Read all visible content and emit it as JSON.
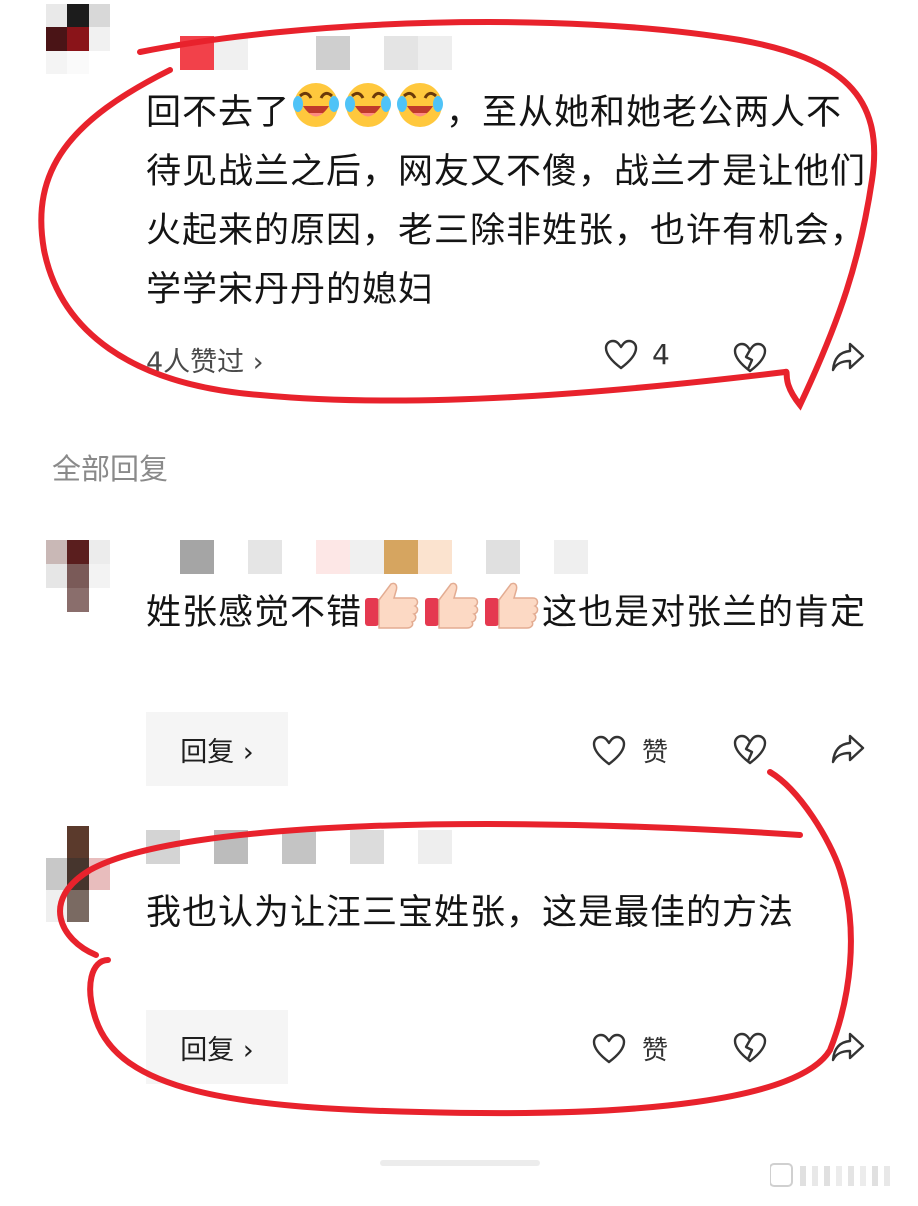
{
  "colors": {
    "annotation": "#e8222c",
    "icon": "#333333",
    "reply_bg": "#f5f5f5",
    "muted": "#8a8a8a"
  },
  "main_comment": {
    "text": "回不去了",
    "emoji": [
      "laughing-tears-emoji",
      "laughing-tears-emoji",
      "laughing-tears-emoji"
    ],
    "text_after": "，至从她和她老公两人不待见战兰之后，网友又不傻，战兰才是让他们火起来的原因，老三除非姓张，也许有机会，学学宋丹丹的媳妇",
    "likers": "4人赞过 ›",
    "like_count": "4"
  },
  "replies_header": "全部回复",
  "replies": [
    {
      "text_before": "姓张感觉不错",
      "emoji": [
        "thumbs-up-emoji",
        "thumbs-up-emoji",
        "thumbs-up-emoji"
      ],
      "text_after": "这也是对张兰的肯定",
      "reply_label": "回复 ›",
      "like_label": "赞"
    },
    {
      "text": "我也认为让汪三宝姓张，这是最佳的方法",
      "reply_label": "回复 ›",
      "like_label": "赞"
    }
  ]
}
